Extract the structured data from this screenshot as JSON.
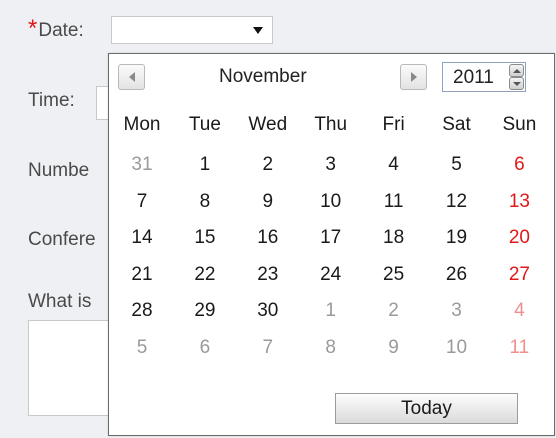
{
  "form": {
    "date_required_mark": "*",
    "date_label": "Date:",
    "date_value": "",
    "time_label": "Time:",
    "number_label_partial": "Numbe",
    "conference_label_partial": "Confere",
    "question_label_partial": "What is"
  },
  "calendar": {
    "month": "November",
    "year": "2011",
    "weekdays": [
      "Mon",
      "Tue",
      "Wed",
      "Thu",
      "Fri",
      "Sat",
      "Sun"
    ],
    "weeks": [
      [
        "31",
        "1",
        "2",
        "3",
        "4",
        "5",
        "6"
      ],
      [
        "7",
        "8",
        "9",
        "10",
        "11",
        "12",
        "13"
      ],
      [
        "14",
        "15",
        "16",
        "17",
        "18",
        "19",
        "20"
      ],
      [
        "21",
        "22",
        "23",
        "24",
        "25",
        "26",
        "27"
      ],
      [
        "28",
        "29",
        "30",
        "1",
        "2",
        "3",
        "4"
      ],
      [
        "5",
        "6",
        "7",
        "8",
        "9",
        "10",
        "11"
      ]
    ],
    "today_label": "Today",
    "colors": {
      "weekend": "#e01818",
      "other_month": "#9a9a9a",
      "other_month_weekend": "#ef8f8f",
      "current_month": "#1a1a1a"
    }
  },
  "icons": {
    "prev": "chevron-left-icon",
    "next": "chevron-right-icon",
    "dropdown": "dropdown-arrow-icon",
    "spin_up": "spin-up-icon",
    "spin_down": "spin-down-icon"
  }
}
